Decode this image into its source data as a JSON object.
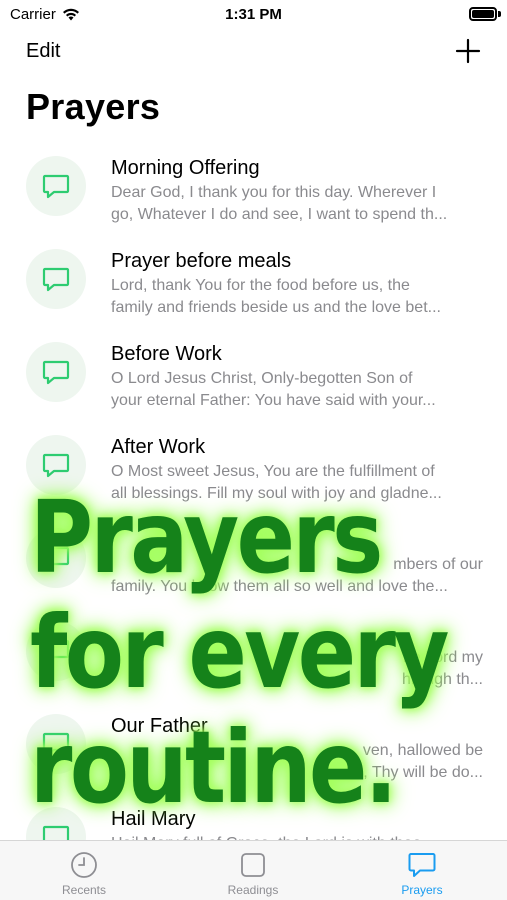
{
  "status_bar": {
    "carrier": "Carrier",
    "time": "1:31 PM"
  },
  "nav": {
    "edit_label": "Edit"
  },
  "page": {
    "title": "Prayers"
  },
  "prayers": [
    {
      "title": "Morning Offering",
      "line1": "Dear God, I thank you for this day. Wherever I",
      "line2": "go, Whatever I do and see, I want to spend th..."
    },
    {
      "title": "Prayer before meals",
      "line1": "Lord, thank You for the food before us, the",
      "line2": "family and friends beside us and the love bet..."
    },
    {
      "title": "Before Work",
      "line1": "O Lord Jesus Christ, Only-begotten Son of",
      "line2": "your eternal Father: You have said with your..."
    },
    {
      "title": "After Work",
      "line1": "O Most sweet Jesus, You are the fulfillment of",
      "line2": "all blessings. Fill my soul with joy and gladne..."
    },
    {
      "title": "",
      "line1": "mbers of our",
      "line2": "family. You know them all so well and love the..."
    },
    {
      "title": "",
      "line1": "he Lord my",
      "line2": "hrough th..."
    },
    {
      "title": "Our Father",
      "line1": "ven, hallowed be",
      "line2": "ne, Thy will be do..."
    },
    {
      "title": "Hail Mary",
      "line1": "Hail Mary full of Grace, the Lord is with thee",
      "line2": ""
    }
  ],
  "overlay": {
    "line1": "Prayers",
    "line2": "for every",
    "line3": "routine."
  },
  "tabs": [
    {
      "label": "Recents",
      "icon": "clock-icon"
    },
    {
      "label": "Readings",
      "icon": "square-icon"
    },
    {
      "label": "Prayers",
      "icon": "chat-bubble-icon"
    }
  ],
  "colors": {
    "accent_green": "#2ecc71",
    "tab_active": "#1a9cf0",
    "overlay_green": "#15821a"
  }
}
